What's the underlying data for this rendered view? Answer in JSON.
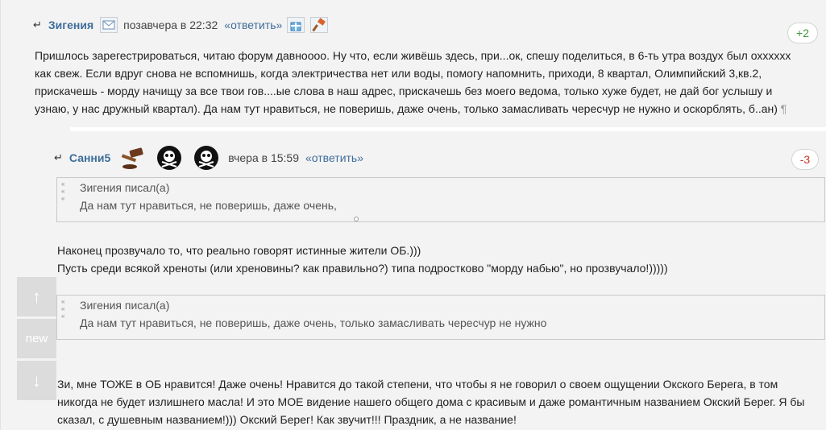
{
  "post1": {
    "back_icon": "reply-arrow-icon",
    "author": "Зигения",
    "date": "позавчера в 22:32",
    "reply_label": "«ответить»",
    "rating": "+2",
    "text": "Пришлось зарегестрироваться, читаю форум давноооо. Ну что, если живёшь здесь, при...ок, спешу поделиться, в 6-ть утра воздух был охххххх как свеж. Если вдруг снова не вспомнишь, когда электричества нет или воды, помогу напомнить, приходи, 8 квартал, Олимпийский 3,кв.2, прискачешь - морду начищу за все твои гов....ые слова в наш адрес, прискачешь без моего ведома, только хуже будет, не дай бог услышу и узнаю, у нас дружный квартал). Да нам тут нравиться, не поверишь, даже очень, только замасливать чересчур не нужно и оскорблять, б..ан)",
    "pilcrow": "¶"
  },
  "post2": {
    "author": "Санни5",
    "date": "вчера в 15:59",
    "reply_label": "«ответить»",
    "rating": "-3",
    "quote1": {
      "author": "Зигения писал(а)",
      "text": "Да нам тут нравиться, не поверишь, даже очень,"
    },
    "paragraph1_line1": "Наконец прозвучало то, что реально говорят истинные жители ОБ.)))",
    "paragraph1_line2": "Пусть среди всякой хреноты (или хреновины? как правильно?) типа подростково \"морду набью\", но прозвучало!)))))",
    "quote2": {
      "author": "Зигения писал(а)",
      "text": "Да нам тут нравиться, не поверишь, даже очень, только замасливать чересчур не нужно"
    },
    "paragraph2": "Зи, мне ТОЖЕ в ОБ нравится! Даже очень! Нравится до такой степени, что чтобы я не говорил о своем ощущении Окского Берега, в том никогда не будет излишнего масла! И это МОЕ видение нашего общего дома с красивым и даже романтичным названием Окский Берег. Я бы сказал, с душевным названием!))) Окский Берег! Как звучит!!! Праздник, а не название!"
  },
  "nav": {
    "up_icon": "↑",
    "new_label": "new",
    "down_icon": "↓"
  },
  "colors": {
    "link": "#3e6d9a",
    "positive": "#3a9a3a",
    "negative": "#c43a2b",
    "background": "#f3f3f3"
  }
}
